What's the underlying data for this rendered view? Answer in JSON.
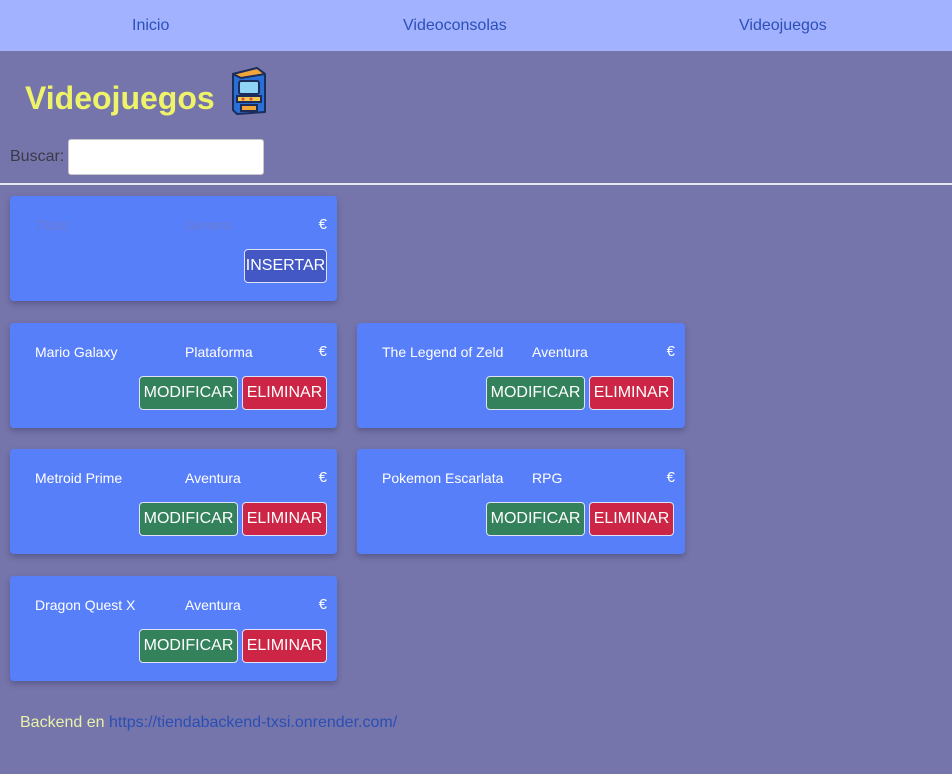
{
  "nav": {
    "items": [
      {
        "label": "Inicio"
      },
      {
        "label": "Videoconsolas"
      },
      {
        "label": "Videojuegos"
      }
    ]
  },
  "header": {
    "title": "Videojuegos",
    "icon": "arcade-cabinet-icon"
  },
  "search": {
    "label": "Buscar:",
    "value": "",
    "placeholder": ""
  },
  "new_item": {
    "title_placeholder": "Titulo",
    "genre_placeholder": "Genero",
    "currency": "€",
    "insert_label": "INSERTAR"
  },
  "games": [
    {
      "title": "Mario Galaxy",
      "genre": "Plataforma",
      "currency": "€"
    },
    {
      "title": "The Legend of Zeld",
      "genre": "Aventura",
      "currency": "€"
    },
    {
      "title": "Metroid Prime",
      "genre": "Aventura",
      "currency": "€"
    },
    {
      "title": "Pokemon Escarlata",
      "genre": "RPG",
      "currency": "€"
    },
    {
      "title": "Dragon Quest X",
      "genre": "Aventura",
      "currency": "€"
    }
  ],
  "actions": {
    "modify_label": "MODIFICAR",
    "delete_label": "ELIMINAR"
  },
  "footer": {
    "label": "Backend en",
    "link_text": "https://tiendabackend-txsi.onrender.com/"
  },
  "colors": {
    "background": "#7575ab",
    "navbar": "#a2b2fe",
    "card": "#587ffa",
    "title": "#eef36a",
    "modify": "#33825c",
    "delete": "#cd2545",
    "insert": "#4358c4"
  }
}
